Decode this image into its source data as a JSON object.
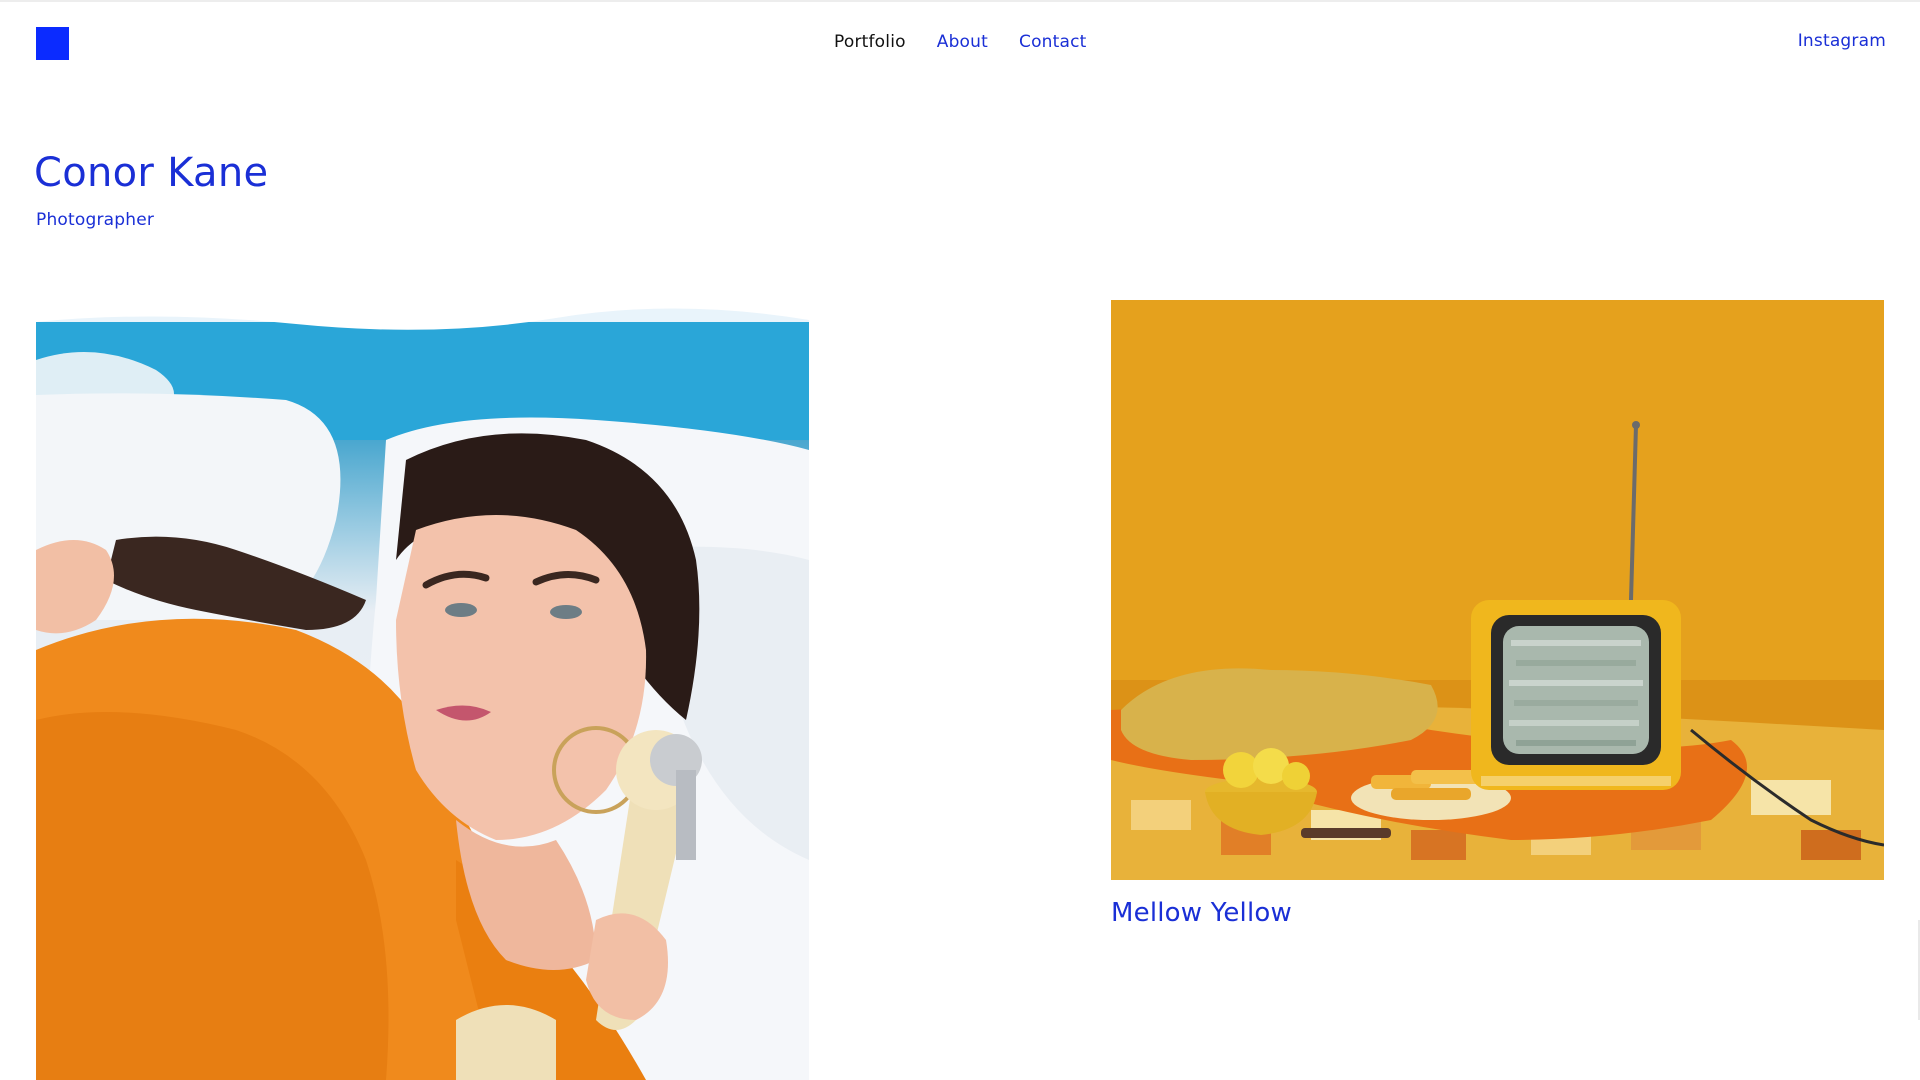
{
  "brand": {
    "logo_color": "#0b2bff"
  },
  "nav": {
    "items": [
      {
        "label": "Portfolio",
        "active": true
      },
      {
        "label": "About",
        "active": false
      },
      {
        "label": "Contact",
        "active": false
      }
    ],
    "social_label": "Instagram"
  },
  "hero": {
    "name": "Conor Kane",
    "role": "Photographer"
  },
  "projects": [
    {
      "caption": "",
      "photo": "woman-with-vintage-phone-photo"
    },
    {
      "caption": "Mellow Yellow",
      "photo": "mellow-yellow-tv-still-life-photo"
    }
  ],
  "colors": {
    "accent": "#1a2fd6",
    "active_nav": "#111111",
    "background": "#ffffff"
  }
}
